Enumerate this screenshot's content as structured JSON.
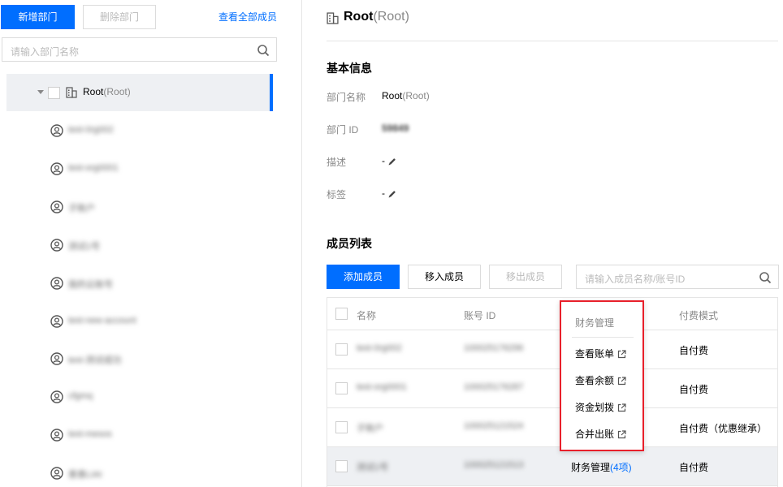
{
  "left_panel": {
    "add_dept_label": "新增部门",
    "delete_dept_label": "删除部门",
    "view_all_label": "查看全部成员",
    "search_placeholder": "请输入部门名称",
    "root": {
      "name": "Root",
      "suffix": "(Root)"
    },
    "members": [
      "test-0rg002",
      "test-org0001",
      "子账户",
      "测试1号",
      "我的云账号",
      "test-new-account",
      "test-测试成功",
      "cfgmq",
      "test-mesos",
      "善善LIAI"
    ]
  },
  "dept": {
    "title": "Root",
    "title_suffix": "(Root)",
    "basic_info_title": "基本信息",
    "name_key": "部门名称",
    "name_value": "Root",
    "name_suffix": "(Root)",
    "id_key": "部门 ID",
    "id_value": "59849",
    "desc_key": "描述",
    "desc_value": "-",
    "tag_key": "标签",
    "tag_value": "-"
  },
  "members_section": {
    "title": "成员列表",
    "add_label": "添加成员",
    "move_in_label": "移入成员",
    "move_out_label": "移出成员",
    "search_placeholder": "请输入成员名称/账号ID",
    "columns": {
      "name": "名称",
      "account_id": "账号 ID",
      "pay_mode": "付费模式"
    },
    "rows": [
      {
        "name": "test-0rg002",
        "account_id": "100025176296",
        "finance": "",
        "finance_count": "",
        "pay_mode": "自付费"
      },
      {
        "name": "test-org0001",
        "account_id": "100025176287",
        "finance": "",
        "finance_count": "",
        "pay_mode": "自付费"
      },
      {
        "name": "子账户",
        "account_id": "100025121524",
        "finance": "",
        "finance_count": "",
        "pay_mode": "自付费（优惠继承）"
      },
      {
        "name": "测试1号",
        "account_id": "100025121513",
        "finance": "财务管理",
        "finance_count": "(4项)",
        "pay_mode": "自付费"
      }
    ]
  },
  "finance_popup": {
    "title": "财务管理",
    "items": [
      "查看账单",
      "查看余额",
      "资金划拨",
      "合并出账"
    ]
  },
  "colors": {
    "primary": "#006eff",
    "highlight_border": "#e8202b",
    "selected_bg": "#eef0f3"
  }
}
